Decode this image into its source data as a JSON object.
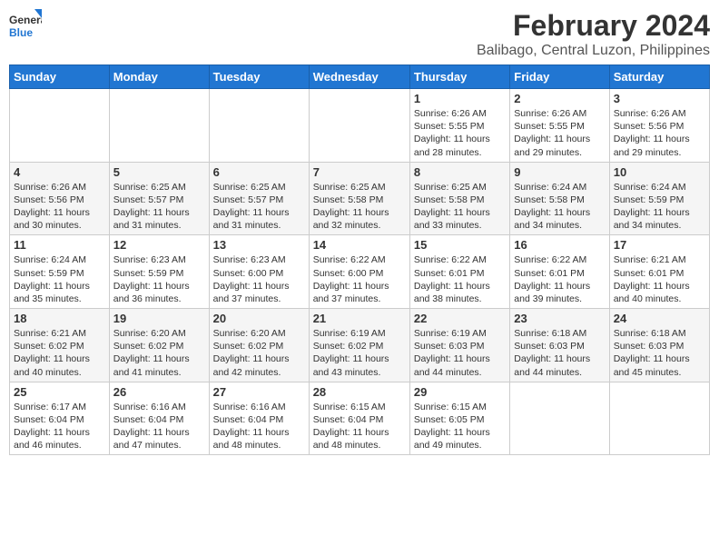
{
  "logo": {
    "text_general": "General",
    "text_blue": "Blue"
  },
  "header": {
    "title": "February 2024",
    "subtitle": "Balibago, Central Luzon, Philippines"
  },
  "columns": [
    "Sunday",
    "Monday",
    "Tuesday",
    "Wednesday",
    "Thursday",
    "Friday",
    "Saturday"
  ],
  "weeks": [
    [
      {
        "day": "",
        "info": ""
      },
      {
        "day": "",
        "info": ""
      },
      {
        "day": "",
        "info": ""
      },
      {
        "day": "",
        "info": ""
      },
      {
        "day": "1",
        "info": "Sunrise: 6:26 AM\nSunset: 5:55 PM\nDaylight: 11 hours\nand 28 minutes."
      },
      {
        "day": "2",
        "info": "Sunrise: 6:26 AM\nSunset: 5:55 PM\nDaylight: 11 hours\nand 29 minutes."
      },
      {
        "day": "3",
        "info": "Sunrise: 6:26 AM\nSunset: 5:56 PM\nDaylight: 11 hours\nand 29 minutes."
      }
    ],
    [
      {
        "day": "4",
        "info": "Sunrise: 6:26 AM\nSunset: 5:56 PM\nDaylight: 11 hours\nand 30 minutes."
      },
      {
        "day": "5",
        "info": "Sunrise: 6:25 AM\nSunset: 5:57 PM\nDaylight: 11 hours\nand 31 minutes."
      },
      {
        "day": "6",
        "info": "Sunrise: 6:25 AM\nSunset: 5:57 PM\nDaylight: 11 hours\nand 31 minutes."
      },
      {
        "day": "7",
        "info": "Sunrise: 6:25 AM\nSunset: 5:58 PM\nDaylight: 11 hours\nand 32 minutes."
      },
      {
        "day": "8",
        "info": "Sunrise: 6:25 AM\nSunset: 5:58 PM\nDaylight: 11 hours\nand 33 minutes."
      },
      {
        "day": "9",
        "info": "Sunrise: 6:24 AM\nSunset: 5:58 PM\nDaylight: 11 hours\nand 34 minutes."
      },
      {
        "day": "10",
        "info": "Sunrise: 6:24 AM\nSunset: 5:59 PM\nDaylight: 11 hours\nand 34 minutes."
      }
    ],
    [
      {
        "day": "11",
        "info": "Sunrise: 6:24 AM\nSunset: 5:59 PM\nDaylight: 11 hours\nand 35 minutes."
      },
      {
        "day": "12",
        "info": "Sunrise: 6:23 AM\nSunset: 5:59 PM\nDaylight: 11 hours\nand 36 minutes."
      },
      {
        "day": "13",
        "info": "Sunrise: 6:23 AM\nSunset: 6:00 PM\nDaylight: 11 hours\nand 37 minutes."
      },
      {
        "day": "14",
        "info": "Sunrise: 6:22 AM\nSunset: 6:00 PM\nDaylight: 11 hours\nand 37 minutes."
      },
      {
        "day": "15",
        "info": "Sunrise: 6:22 AM\nSunset: 6:01 PM\nDaylight: 11 hours\nand 38 minutes."
      },
      {
        "day": "16",
        "info": "Sunrise: 6:22 AM\nSunset: 6:01 PM\nDaylight: 11 hours\nand 39 minutes."
      },
      {
        "day": "17",
        "info": "Sunrise: 6:21 AM\nSunset: 6:01 PM\nDaylight: 11 hours\nand 40 minutes."
      }
    ],
    [
      {
        "day": "18",
        "info": "Sunrise: 6:21 AM\nSunset: 6:02 PM\nDaylight: 11 hours\nand 40 minutes."
      },
      {
        "day": "19",
        "info": "Sunrise: 6:20 AM\nSunset: 6:02 PM\nDaylight: 11 hours\nand 41 minutes."
      },
      {
        "day": "20",
        "info": "Sunrise: 6:20 AM\nSunset: 6:02 PM\nDaylight: 11 hours\nand 42 minutes."
      },
      {
        "day": "21",
        "info": "Sunrise: 6:19 AM\nSunset: 6:02 PM\nDaylight: 11 hours\nand 43 minutes."
      },
      {
        "day": "22",
        "info": "Sunrise: 6:19 AM\nSunset: 6:03 PM\nDaylight: 11 hours\nand 44 minutes."
      },
      {
        "day": "23",
        "info": "Sunrise: 6:18 AM\nSunset: 6:03 PM\nDaylight: 11 hours\nand 44 minutes."
      },
      {
        "day": "24",
        "info": "Sunrise: 6:18 AM\nSunset: 6:03 PM\nDaylight: 11 hours\nand 45 minutes."
      }
    ],
    [
      {
        "day": "25",
        "info": "Sunrise: 6:17 AM\nSunset: 6:04 PM\nDaylight: 11 hours\nand 46 minutes."
      },
      {
        "day": "26",
        "info": "Sunrise: 6:16 AM\nSunset: 6:04 PM\nDaylight: 11 hours\nand 47 minutes."
      },
      {
        "day": "27",
        "info": "Sunrise: 6:16 AM\nSunset: 6:04 PM\nDaylight: 11 hours\nand 48 minutes."
      },
      {
        "day": "28",
        "info": "Sunrise: 6:15 AM\nSunset: 6:04 PM\nDaylight: 11 hours\nand 48 minutes."
      },
      {
        "day": "29",
        "info": "Sunrise: 6:15 AM\nSunset: 6:05 PM\nDaylight: 11 hours\nand 49 minutes."
      },
      {
        "day": "",
        "info": ""
      },
      {
        "day": "",
        "info": ""
      }
    ]
  ]
}
